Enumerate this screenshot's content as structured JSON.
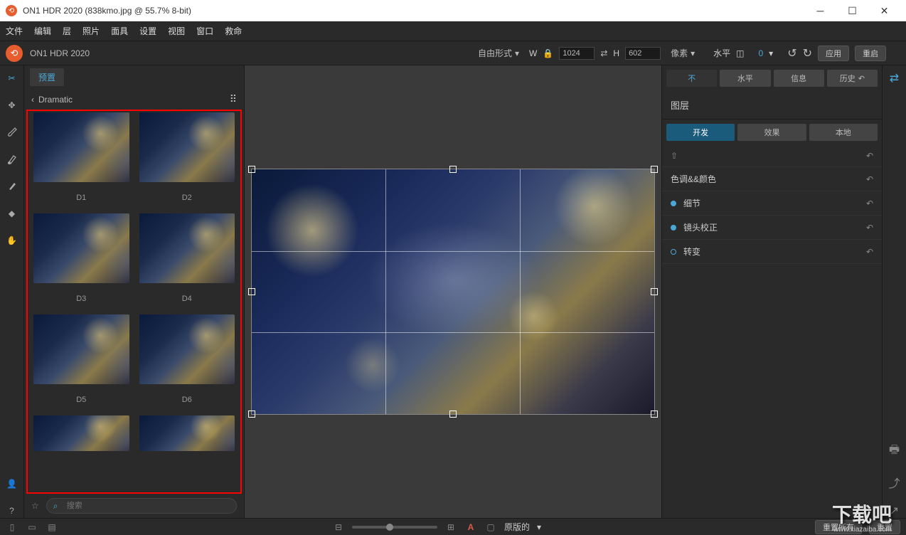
{
  "titlebar": {
    "title": "ON1 HDR 2020 (838kmo.jpg @ 55.7% 8-bit)"
  },
  "menubar": [
    "文件",
    "编辑",
    "层",
    "照片",
    "面具",
    "设置",
    "视图",
    "窗口",
    "救命"
  ],
  "subheader": {
    "app_name": "ON1 HDR 2020",
    "mode_label": "自由形式",
    "w_label": "W",
    "w_value": "1024",
    "h_label": "H",
    "h_value": "602",
    "unit_label": "像素",
    "level_label": "水平",
    "angle_value": "0",
    "apply_label": "应用",
    "reset_label": "重启"
  },
  "preset": {
    "tab_label": "预置",
    "breadcrumb": "Dramatic",
    "items": [
      "D1",
      "D2",
      "D3",
      "D4",
      "D5",
      "D6",
      "",
      ""
    ],
    "search_placeholder": "搜索"
  },
  "right": {
    "tabs": [
      "不",
      "水平",
      "信息",
      "历史"
    ],
    "layers_title": "图层",
    "subtabs": [
      "开发",
      "效果",
      "本地"
    ],
    "rows": {
      "share": "",
      "tone": "色调&&颜色",
      "detail": "细节",
      "lens": "镜头校正",
      "transform": "转变"
    }
  },
  "bottom": {
    "origin_label": "原版的",
    "reset_all": "重置所有",
    "reset": "重置"
  },
  "watermark": {
    "big": "下载吧",
    "sub": "www.xiazaiba.com"
  }
}
